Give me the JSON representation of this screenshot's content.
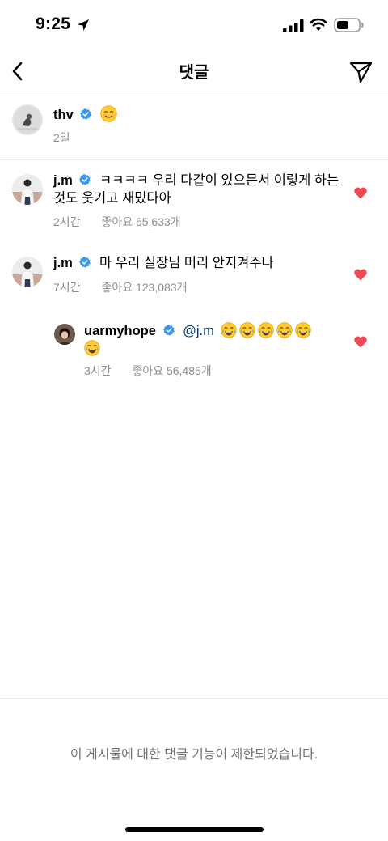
{
  "status_bar": {
    "time": "9:25"
  },
  "nav": {
    "title": "댓글"
  },
  "caption": {
    "username": "thv",
    "time": "2일"
  },
  "comments": [
    {
      "username": "j.m",
      "text_line1": "ㅋㅋㅋㅋ 우리 다같이 있으믄서 이렇게 하는",
      "text_line2": "것도 웃기고 재밌다아",
      "time": "2시간",
      "likes": "좋아요 55,633개"
    },
    {
      "username": "j.m",
      "text_line1": "마 우리 실장님 머리 안지켜주나",
      "time": "7시간",
      "likes": "좋아요 123,083개"
    }
  ],
  "reply": {
    "username": "uarmyhope",
    "mention": "@j.m",
    "time": "3시간",
    "likes": "좋아요 56,485개"
  },
  "footer": {
    "notice": "이 게시물에 대한 댓글 기능이 제한되었습니다."
  },
  "colors": {
    "verified": "#3897f0",
    "heart": "#ed4956",
    "meta": "#8e8e8e"
  }
}
